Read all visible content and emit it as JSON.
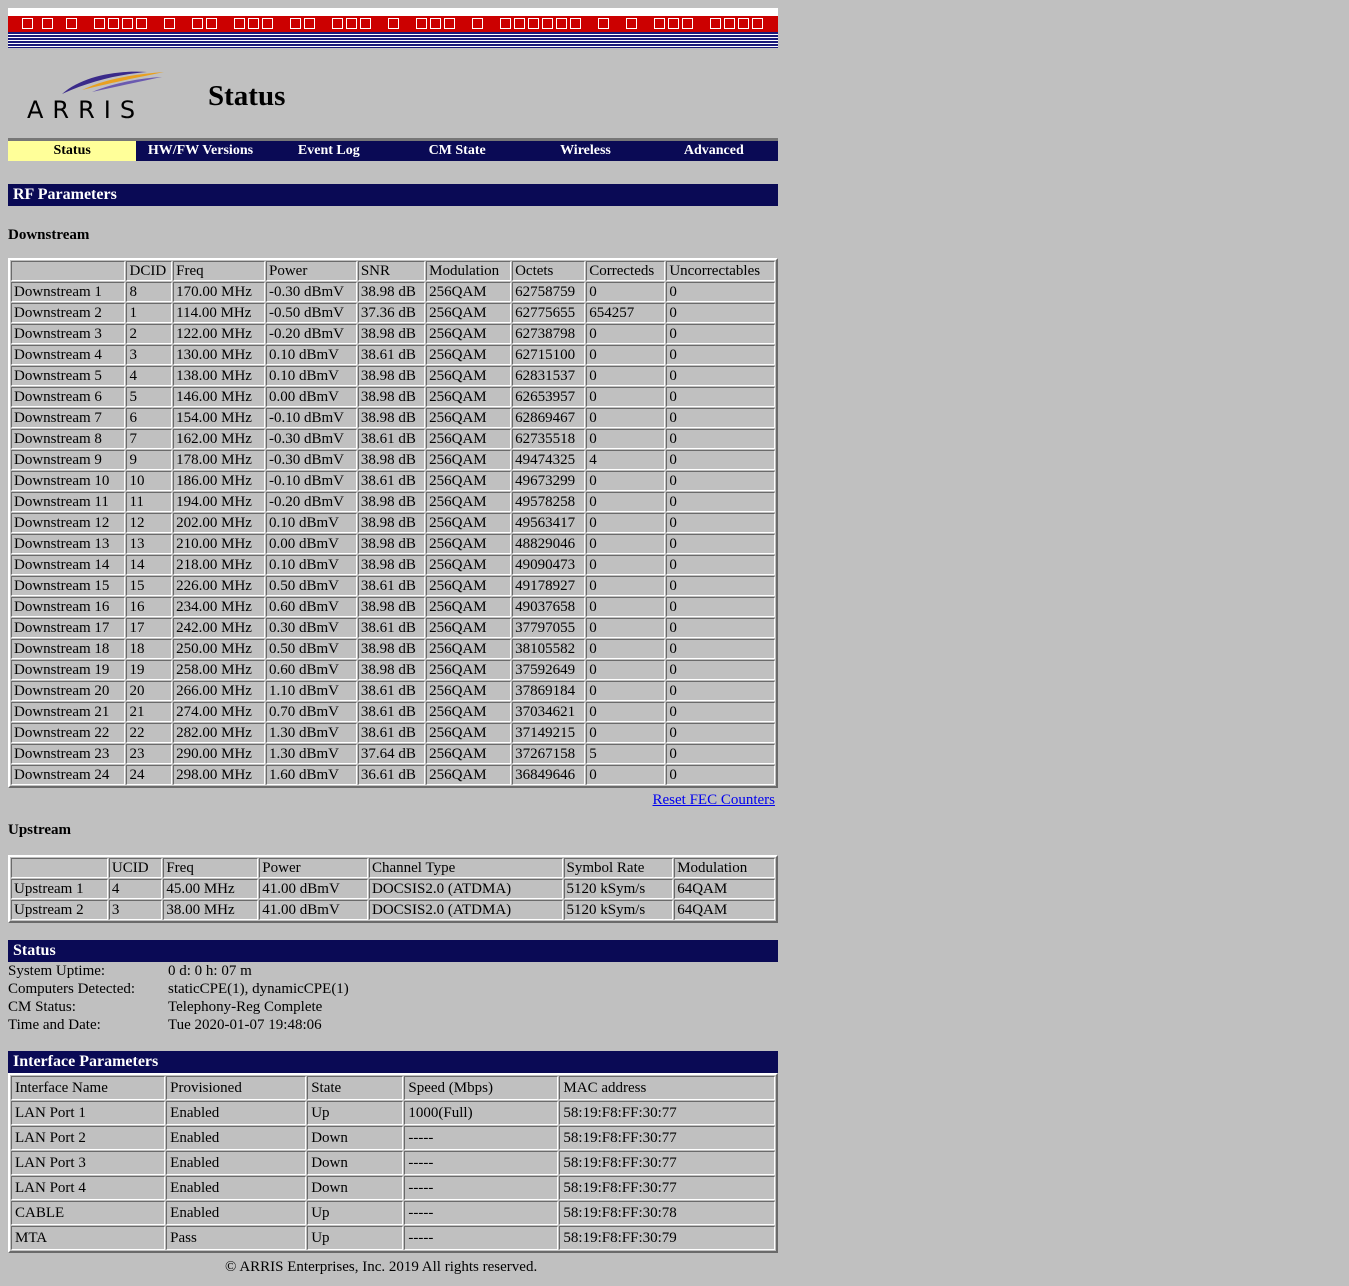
{
  "header": {
    "logo_text": "ARRIS",
    "title": "Status",
    "colors": {
      "banner_red": "#cc0000",
      "navy": "#0a0a55",
      "active_tab": "#ffff99",
      "background": "#c0c0c0"
    }
  },
  "nav": {
    "tabs": [
      "Status",
      "HW/FW Versions",
      "Event Log",
      "CM State",
      "Wireless",
      "Advanced"
    ],
    "active": "Status"
  },
  "rf": {
    "section_title": "RF Parameters",
    "downstream_title": "Downstream",
    "downstream_headers": [
      "",
      "DCID",
      "Freq",
      "Power",
      "SNR",
      "Modulation",
      "Octets",
      "Correcteds",
      "Uncorrectables"
    ],
    "downstream_rows": [
      [
        "Downstream 1",
        "8",
        "170.00 MHz",
        "-0.30 dBmV",
        "38.98 dB",
        "256QAM",
        "62758759",
        "0",
        "0"
      ],
      [
        "Downstream 2",
        "1",
        "114.00 MHz",
        "-0.50 dBmV",
        "37.36 dB",
        "256QAM",
        "62775655",
        "654257",
        "0"
      ],
      [
        "Downstream 3",
        "2",
        "122.00 MHz",
        "-0.20 dBmV",
        "38.98 dB",
        "256QAM",
        "62738798",
        "0",
        "0"
      ],
      [
        "Downstream 4",
        "3",
        "130.00 MHz",
        "0.10 dBmV",
        "38.61 dB",
        "256QAM",
        "62715100",
        "0",
        "0"
      ],
      [
        "Downstream 5",
        "4",
        "138.00 MHz",
        "0.10 dBmV",
        "38.98 dB",
        "256QAM",
        "62831537",
        "0",
        "0"
      ],
      [
        "Downstream 6",
        "5",
        "146.00 MHz",
        "0.00 dBmV",
        "38.98 dB",
        "256QAM",
        "62653957",
        "0",
        "0"
      ],
      [
        "Downstream 7",
        "6",
        "154.00 MHz",
        "-0.10 dBmV",
        "38.98 dB",
        "256QAM",
        "62869467",
        "0",
        "0"
      ],
      [
        "Downstream 8",
        "7",
        "162.00 MHz",
        "-0.30 dBmV",
        "38.61 dB",
        "256QAM",
        "62735518",
        "0",
        "0"
      ],
      [
        "Downstream 9",
        "9",
        "178.00 MHz",
        "-0.30 dBmV",
        "38.98 dB",
        "256QAM",
        "49474325",
        "4",
        "0"
      ],
      [
        "Downstream 10",
        "10",
        "186.00 MHz",
        "-0.10 dBmV",
        "38.61 dB",
        "256QAM",
        "49673299",
        "0",
        "0"
      ],
      [
        "Downstream 11",
        "11",
        "194.00 MHz",
        "-0.20 dBmV",
        "38.98 dB",
        "256QAM",
        "49578258",
        "0",
        "0"
      ],
      [
        "Downstream 12",
        "12",
        "202.00 MHz",
        "0.10 dBmV",
        "38.98 dB",
        "256QAM",
        "49563417",
        "0",
        "0"
      ],
      [
        "Downstream 13",
        "13",
        "210.00 MHz",
        "0.00 dBmV",
        "38.98 dB",
        "256QAM",
        "48829046",
        "0",
        "0"
      ],
      [
        "Downstream 14",
        "14",
        "218.00 MHz",
        "0.10 dBmV",
        "38.98 dB",
        "256QAM",
        "49090473",
        "0",
        "0"
      ],
      [
        "Downstream 15",
        "15",
        "226.00 MHz",
        "0.50 dBmV",
        "38.61 dB",
        "256QAM",
        "49178927",
        "0",
        "0"
      ],
      [
        "Downstream 16",
        "16",
        "234.00 MHz",
        "0.60 dBmV",
        "38.98 dB",
        "256QAM",
        "49037658",
        "0",
        "0"
      ],
      [
        "Downstream 17",
        "17",
        "242.00 MHz",
        "0.30 dBmV",
        "38.61 dB",
        "256QAM",
        "37797055",
        "0",
        "0"
      ],
      [
        "Downstream 18",
        "18",
        "250.00 MHz",
        "0.50 dBmV",
        "38.98 dB",
        "256QAM",
        "38105582",
        "0",
        "0"
      ],
      [
        "Downstream 19",
        "19",
        "258.00 MHz",
        "0.60 dBmV",
        "38.98 dB",
        "256QAM",
        "37592649",
        "0",
        "0"
      ],
      [
        "Downstream 20",
        "20",
        "266.00 MHz",
        "1.10 dBmV",
        "38.61 dB",
        "256QAM",
        "37869184",
        "0",
        "0"
      ],
      [
        "Downstream 21",
        "21",
        "274.00 MHz",
        "0.70 dBmV",
        "38.61 dB",
        "256QAM",
        "37034621",
        "0",
        "0"
      ],
      [
        "Downstream 22",
        "22",
        "282.00 MHz",
        "1.30 dBmV",
        "38.61 dB",
        "256QAM",
        "37149215",
        "0",
        "0"
      ],
      [
        "Downstream 23",
        "23",
        "290.00 MHz",
        "1.30 dBmV",
        "37.64 dB",
        "256QAM",
        "37267158",
        "5",
        "0"
      ],
      [
        "Downstream 24",
        "24",
        "298.00 MHz",
        "1.60 dBmV",
        "36.61 dB",
        "256QAM",
        "36849646",
        "0",
        "0"
      ]
    ],
    "reset_link": "Reset FEC Counters",
    "upstream_title": "Upstream",
    "upstream_headers": [
      "",
      "UCID",
      "Freq",
      "Power",
      "Channel Type",
      "Symbol Rate",
      "Modulation"
    ],
    "upstream_rows": [
      [
        "Upstream 1",
        "4",
        "45.00 MHz",
        "41.00 dBmV",
        "DOCSIS2.0 (ATDMA)",
        "5120 kSym/s",
        "64QAM"
      ],
      [
        "Upstream 2",
        "3",
        "38.00 MHz",
        "41.00 dBmV",
        "DOCSIS2.0 (ATDMA)",
        "5120 kSym/s",
        "64QAM"
      ]
    ]
  },
  "status": {
    "section_title": "Status",
    "rows": [
      {
        "label": "System Uptime:",
        "value": "0 d: 0 h: 07 m"
      },
      {
        "label": "Computers Detected:",
        "value": "staticCPE(1), dynamicCPE(1)"
      },
      {
        "label": "CM Status:",
        "value": "Telephony-Reg Complete"
      },
      {
        "label": "Time and Date:",
        "value": "Tue 2020-01-07 19:48:06"
      }
    ]
  },
  "interfaces": {
    "section_title": "Interface Parameters",
    "headers": [
      "Interface Name",
      "Provisioned",
      "State",
      "Speed (Mbps)",
      "MAC address"
    ],
    "rows": [
      [
        "LAN Port 1",
        "Enabled",
        "Up",
        "1000(Full)",
        "58:19:F8:FF:30:77"
      ],
      [
        "LAN Port 2",
        "Enabled",
        "Down",
        "-----",
        "58:19:F8:FF:30:77"
      ],
      [
        "LAN Port 3",
        "Enabled",
        "Down",
        "-----",
        "58:19:F8:FF:30:77"
      ],
      [
        "LAN Port 4",
        "Enabled",
        "Down",
        "-----",
        "58:19:F8:FF:30:77"
      ],
      [
        "CABLE",
        "Enabled",
        "Up",
        "-----",
        "58:19:F8:FF:30:78"
      ],
      [
        "MTA",
        "Pass",
        "Up",
        "-----",
        "58:19:F8:FF:30:79"
      ]
    ]
  },
  "footer": {
    "copyright": "© ARRIS Enterprises, Inc. 2019 All rights reserved."
  }
}
